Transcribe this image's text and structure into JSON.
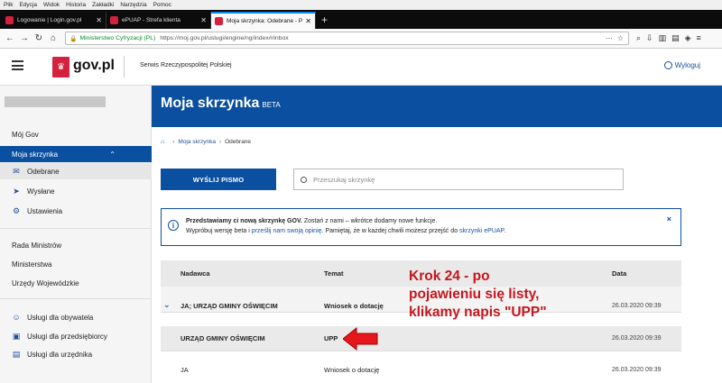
{
  "browser": {
    "menu": [
      "Plik",
      "Edycja",
      "Widok",
      "Historia",
      "Zakładki",
      "Narzędzia",
      "Pomoc"
    ],
    "tabs": [
      {
        "title": "Logowanie | Login.gov.pl",
        "favicon_color": "#d4213d"
      },
      {
        "title": "ePUAP - Strefa klienta",
        "favicon_color": "#d4213d"
      },
      {
        "title": "Moja skrzynka: Odebrane - Portal",
        "favicon_color": "#d4213d",
        "active": true
      }
    ],
    "new_tab": "+",
    "address": {
      "secure_label": "Ministerstwo Cyfryzacji (PL)",
      "url": "https://moj.gov.pl/uslugi/engine/ng/index#/inbox"
    }
  },
  "header": {
    "logo_text": "gov.pl",
    "service_name": "Serwis Rzeczypospolitej Polskiej",
    "logout": "Wyloguj"
  },
  "sidebar": {
    "items": [
      {
        "label": "Mój Gov"
      },
      {
        "label": "Moja skrzynka",
        "chevron": "⌃"
      },
      {
        "label": "Odebrane",
        "icon": "envelope-icon"
      },
      {
        "label": "Wysłane",
        "icon": "send-icon"
      },
      {
        "label": "Ustawienia",
        "icon": "gear-icon"
      },
      {
        "label": "Rada Ministrów"
      },
      {
        "label": "Ministerstwa"
      },
      {
        "label": "Urzędy Wojewódzkie"
      },
      {
        "label": "Usługi dla obywatela",
        "icon": "person-icon"
      },
      {
        "label": "Usługi dla przedsiębiorcy",
        "icon": "briefcase-icon"
      },
      {
        "label": "Usługi dla urzędnika",
        "icon": "document-icon"
      }
    ]
  },
  "banner": {
    "title": "Moja skrzynka",
    "badge": "BETA"
  },
  "breadcrumb": {
    "items": [
      "Moja skrzynka",
      "Odebrane"
    ]
  },
  "toolbar": {
    "send_label": "WYŚLIJ PISMO",
    "search_placeholder": "Przeszukaj skrzynkę"
  },
  "notice": {
    "bold": "Przedstawiamy ci nową skrzynkę GOV.",
    "line1_rest": " Zostań z nami – wkrótce dodamy nowe funkcje.",
    "line2_a": "Wypróbuj wersję beta i ",
    "line2_link1": "prześlij nam swoją opinię",
    "line2_b": ". Pamiętaj, że w każdej chwili możesz przejść do ",
    "line2_link2": "skrzynki ePUAP",
    "line2_c": ".",
    "close": "×"
  },
  "table": {
    "headers": {
      "sender": "Nadawca",
      "subject": "Temat",
      "date": "Data"
    },
    "rows": [
      {
        "sender": "JA; URZĄD GMINY OŚWIĘCIM",
        "subject": "Wniosek o dotację",
        "date": "26.03.2020 09:39",
        "expander": "⌄"
      },
      {
        "sender": "URZĄD GMINY OŚWIĘCIM",
        "subject": "UPP",
        "date": "26.03.2020 09:39"
      },
      {
        "sender": "JA",
        "subject": "Wniosek o dotację",
        "date": "26.03.2020 09:39"
      }
    ]
  },
  "annotation": {
    "lines": [
      "Krok 24 - po",
      "pojawieniu się listy,",
      "klikamy napis \"UPP\""
    ],
    "color": "#c4161c"
  }
}
